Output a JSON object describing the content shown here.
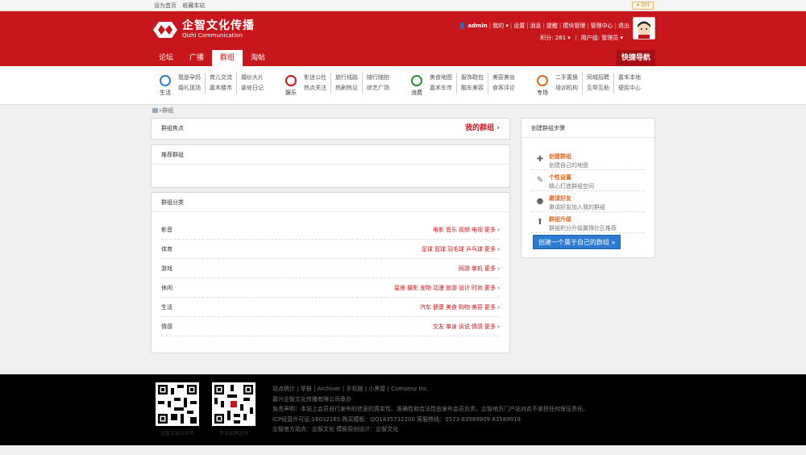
{
  "topbar": {
    "set_home": "设为首页",
    "bookmark": "收藏本站",
    "diy": "DIY"
  },
  "brand": {
    "name_cn": "企智文化传播",
    "name_en": "Qizhi Communication"
  },
  "user": {
    "name": "admin",
    "my": "我的",
    "settings": "设置",
    "messages": "消息",
    "remind": "提醒",
    "modules": "模块管理",
    "admin_center": "管理中心",
    "logout": "退出",
    "points_label": "积分: 281",
    "group_label": "用户组: 管理员"
  },
  "nav": {
    "tabs": [
      "论坛",
      "广播",
      "群组",
      "淘帖"
    ],
    "active": 2,
    "quick": "快捷导航"
  },
  "categories": [
    {
      "label": "生活",
      "color": "#2d7bd0",
      "rows": [
        [
          "我是孕妈",
          "育儿交流",
          "婚纱大片"
        ],
        [
          "婚礼现场",
          "嘉禾楼市",
          "装修日记"
        ]
      ]
    },
    {
      "label": "娱乐",
      "color": "#c8161d",
      "rows": [
        [
          "影迷公社",
          "旅行线路",
          "随行随拍"
        ],
        [
          "热点关注",
          "热刷热议",
          "综艺广场"
        ]
      ]
    },
    {
      "label": "消费",
      "color": "#2e8b3a",
      "rows": [
        [
          "美食地图",
          "服饰鞋包",
          "美容美妆"
        ],
        [
          "嘉禾车市",
          "酷车美容",
          "食客评论"
        ]
      ]
    },
    {
      "label": "专场",
      "color": "#e0661b",
      "rows": [
        [
          "二手置换",
          "同城招聘",
          "嘉禾本地"
        ],
        [
          "培训机构",
          "互帮互助",
          "便民中心"
        ]
      ]
    }
  ],
  "breadcrumb": {
    "sep": "»",
    "current": "群组"
  },
  "focus": {
    "title": "群组焦点",
    "my_group": "我的群组 ›"
  },
  "recommended": {
    "title": "推荐群组"
  },
  "group_categories": {
    "title": "群组分类",
    "rows": [
      {
        "name": "影音",
        "tags": [
          "电影",
          "音乐",
          "视频",
          "电视"
        ],
        "more": "更多 ›"
      },
      {
        "name": "体育",
        "tags": [
          "足球",
          "篮球",
          "羽毛球",
          "乒乓球"
        ],
        "more": "更多 ›"
      },
      {
        "name": "游戏",
        "tags": [
          "网游",
          "单机"
        ],
        "more": "更多 ›"
      },
      {
        "name": "休闲",
        "tags": [
          "星座",
          "摄影",
          "宠物",
          "动漫",
          "旅游",
          "设计",
          "时尚"
        ],
        "more": "更多 ›"
      },
      {
        "name": "生活",
        "tags": [
          "汽车",
          "健康",
          "美食",
          "购物",
          "美容"
        ],
        "more": "更多 ›"
      },
      {
        "name": "情感",
        "tags": [
          "交友",
          "单身",
          "诉说",
          "情感"
        ],
        "more": "更多 ›"
      }
    ]
  },
  "create_steps": {
    "title": "创建群组步骤",
    "steps": [
      {
        "icon": "plus-icon",
        "title": "创建群组",
        "desc": "创建自己的地盘"
      },
      {
        "icon": "wrench-icon",
        "title": "个性设置",
        "desc": "精心打造群组空间"
      },
      {
        "icon": "user-icon",
        "title": "邀请好友",
        "desc": "邀请好友加入我的群组"
      },
      {
        "icon": "arrow-up-icon",
        "title": "群组升级",
        "desc": "群组积分升级赢得社区推荐"
      }
    ],
    "button": "创建一个属于自己的群组 »"
  },
  "footer": {
    "qr1_caption": "企智文化公众号",
    "qr2_caption": "专业品牌咨询",
    "lines": [
      "站点统计 | 举报 | Archiver | 手机版 | 小黑屋 | Comsenz Inc.",
      "嘉兴企智文化传播有限公司承办",
      "免责声明：本站上会员自行发布的信息的真实性、准确性和合法性由发布会员负责，企智地方门户站对此不承担任何保证责任。",
      "ICP经营许可证:16032165 购买模板：QQ1835732200 客服热线：0573-83589909 83589919",
      "企智官方站点：企智文化 模板原创设计：企智文化"
    ]
  },
  "colors": {
    "brand_red": "#c8161d",
    "link_red": "#c8161d",
    "orange": "#e0661b",
    "button_blue": "#2d7bd0"
  }
}
